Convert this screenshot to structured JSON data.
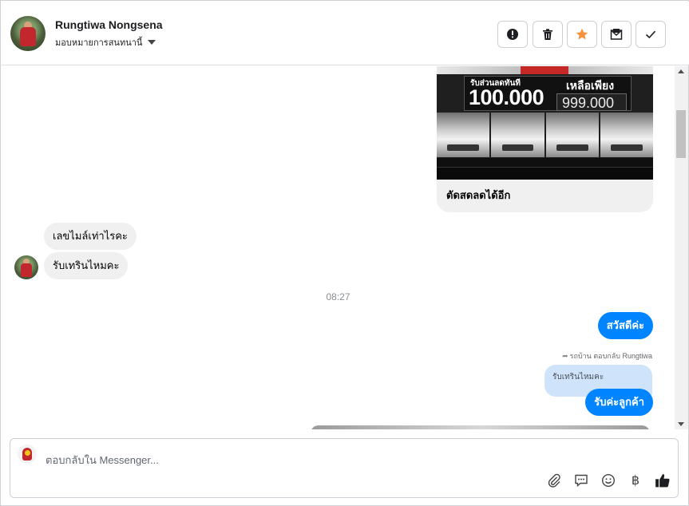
{
  "header": {
    "contact_name": "Rungtiwa Nongsena",
    "assign_label": "มอบหมายการสนทนานี้"
  },
  "chat": {
    "ad": {
      "headline": "รับส่วนลดทันที",
      "discount": "100.000",
      "remaining_label": "เหลือเพียง",
      "price": "999.000",
      "caption": "ตัดสดลดได้อีก"
    },
    "incoming": [
      "เลขไมล์เท่าไรคะ",
      "รับเทรินไหมคะ"
    ],
    "timestamp": "08:27",
    "outgoing": [
      "สวัสดีค่ะ",
      "รับค่ะลูกค้า"
    ],
    "reply_note": "รถบ้าน ตอบกลับ Rungtiwa",
    "quoted_text": "รับเทรินไหมคะ"
  },
  "composer": {
    "placeholder": "ตอบกลับใน Messenger...",
    "baht_symbol": "฿"
  },
  "colors": {
    "messenger_blue": "#0084ff",
    "incoming_bubble": "#f0f0f0",
    "star_orange": "#f7923a"
  }
}
